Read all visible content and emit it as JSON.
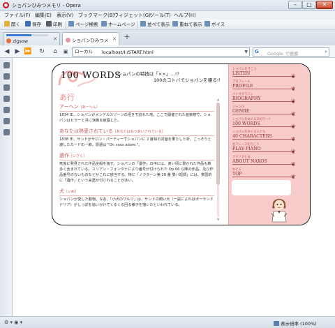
{
  "window": {
    "title": "ショパンひみつメモリ - Opera",
    "controls": {
      "minimize": "–",
      "maximize": "□",
      "close": "✕"
    }
  },
  "menubar": [
    "ファイル(F)",
    "編集(E)",
    "表示(V)",
    "ブックマーク(B)",
    "ウィジェット(G)",
    "ツール(T)",
    "ヘルプ(H)"
  ],
  "toolbar": [
    {
      "label": "開く",
      "icon": "folder-icon",
      "color": "#e0b040"
    },
    {
      "label": "保存",
      "icon": "save-icon",
      "color": "#3a6fb0"
    },
    {
      "label": "印刷",
      "icon": "print-icon",
      "color": "#555d66"
    },
    {
      "label": "ページ検索",
      "icon": "find-icon",
      "color": "#6a8fb8"
    },
    {
      "label": "ホームページ",
      "icon": "home-icon",
      "color": "#6a8fb8"
    },
    {
      "label": "並べて表示",
      "icon": "tile-icon",
      "color": "#6a8fb8"
    },
    {
      "label": "重ねて表示",
      "icon": "cascade-icon",
      "color": "#6a8fb8"
    },
    {
      "label": "ボイス",
      "icon": "voice-icon",
      "color": "#6a8fb8"
    }
  ],
  "tabs": [
    {
      "label": "zigsow",
      "icon": "zigsow-icon",
      "color": "#e0733a",
      "loading": true,
      "progress": 0.6
    },
    {
      "label": "ショパンひみつメモ...",
      "icon": "page-icon",
      "color": "#e39aa6",
      "active": true
    }
  ],
  "newtab": "+",
  "nav": {
    "location_label": "ローカル",
    "url": "localhost/I:/START.html",
    "search_placeholder": "Google で検索",
    "search_engine": "G"
  },
  "page": {
    "logo": "100 WORDS",
    "tagline_1": "ショパンの特技は「××」…!?",
    "tagline_2": "100のコトバでショパンを覗る!!",
    "section": "あ行",
    "entries": [
      {
        "title": "アーヘン",
        "reading": "［あーへん］",
        "body": "1834 年、ショパンがメンデルスゾーンの招きで訪れた地。ここで開催された音楽祭で、ショパンはヒラーと共に演奏を披露した。"
      },
      {
        "title": "あなたは熱愛されている",
        "reading": "［あなたはねつあいされている］",
        "body": "1838 年、サンドがサロン・パーティーでショパンに 2 度目の対面を果たした折、こっそりと渡したカードの一節。原語は \"On vous adore.\"。"
      },
      {
        "title": "遺作",
        "reading": "［いさく］",
        "body": "死後に発見された作品全般を指す。ショパンの「遺作」の中には、弟い頃に書かれた作品も数多く含まれている。ユリアン・フォンタナにより番号が付けられた Op.66 以降の作品、及び作品番号のないものなどがこれに該当する。特に「ノクターン第 20 番 嬰ハ短調」には、慣習的に「遺作」という言葉が付されることが多い。"
      },
      {
        "title": "犬",
        "reading": "［いぬ］",
        "body": "ショパンが愛した動物。なお、「小犬のワルツ」は、サンドの飼い犬（一説によればポーランドドリア）がしっぽを追いかけてくるくる回る様子を描いたといわれている。"
      }
    ],
    "scroll_position": 0.35,
    "nav": [
      {
        "jp": "ショパンをきこう",
        "en": "LISTEN"
      },
      {
        "jp": "プロフィール",
        "en": "PROFILE"
      },
      {
        "jp": "バイオグラフィ",
        "en": "BIOGRAPHY"
      },
      {
        "jp": "ジャンル",
        "en": "GENRE"
      },
      {
        "jp": "ショパンをめぐる100ワード",
        "en": "100 WORDS"
      },
      {
        "jp": "ショパンをめぐる人たち",
        "en": "40 CHARACTERS"
      },
      {
        "jp": "名フレーズをひこう",
        "en": "PLAY PIANO"
      },
      {
        "jp": "ナクソスとは",
        "en": "ABOUT NAXOS"
      },
      {
        "jp": "もどる",
        "en": "TOP"
      }
    ]
  },
  "status": {
    "view": "表示倍率 (100%)",
    "icons": "⚙ ▾ ◉ ▾"
  },
  "colors": {
    "accent_pink": "#f9cccc",
    "heading_pink": "#e98a8a",
    "nav_text": "#8a2d2d",
    "opera_red": "#d0121b"
  }
}
